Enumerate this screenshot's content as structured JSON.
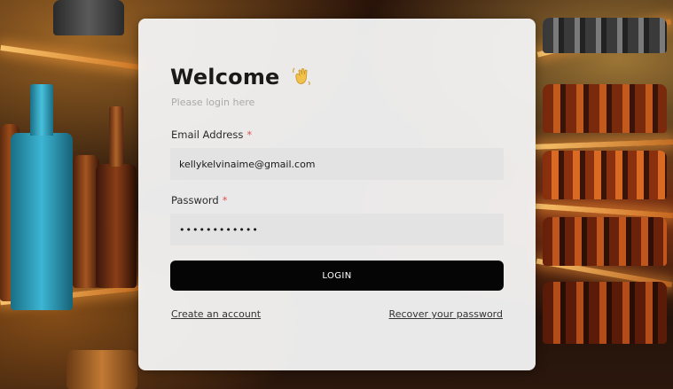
{
  "header": {
    "title": "Welcome",
    "title_icon": "waving-hand-icon",
    "subtitle": "Please login here"
  },
  "form": {
    "email": {
      "label": "Email Address",
      "required_marker": "*",
      "value": "kellykelvinaime@gmail.com"
    },
    "password": {
      "label": "Password",
      "required_marker": "*",
      "value": "••••••••••••"
    },
    "submit_label": "LOGIN"
  },
  "links": {
    "create_account": "Create an account",
    "recover_password": "Recover your password"
  },
  "colors": {
    "button_bg": "#050505",
    "required_marker": "#e05252",
    "card_bg": "#f2f2f2",
    "field_bg": "#e3e3e3"
  }
}
